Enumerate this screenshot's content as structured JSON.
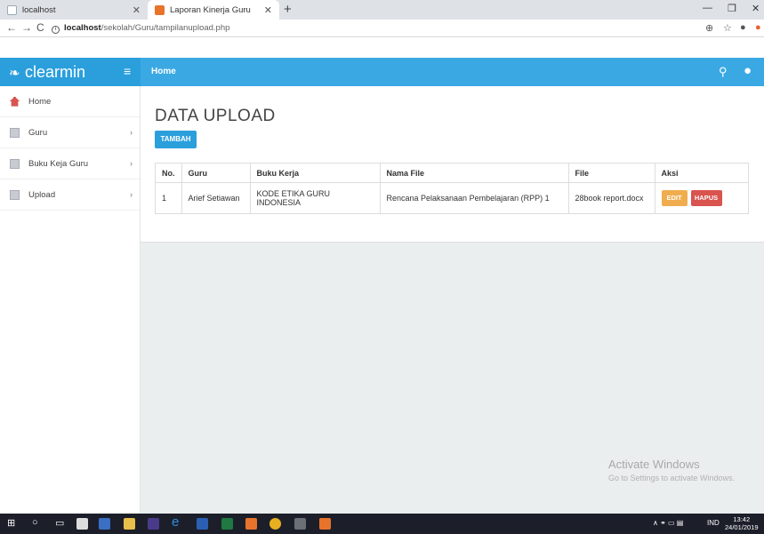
{
  "browser": {
    "tabs": [
      {
        "title": "localhost",
        "active": false
      },
      {
        "title": "Laporan Kinerja Guru",
        "active": true
      }
    ],
    "url_host": "localhost",
    "url_path": "/sekolah/Guru/tampilanupload.php"
  },
  "app": {
    "brand": "clearmin",
    "breadcrumb": "Home",
    "accent_color": "#2a9fdc"
  },
  "sidebar": {
    "items": [
      {
        "label": "Home",
        "icon": "home-icon",
        "has_children": false
      },
      {
        "label": "Guru",
        "icon": "list-icon",
        "has_children": true
      },
      {
        "label": "Buku Keja Guru",
        "icon": "list-icon",
        "has_children": true
      },
      {
        "label": "Upload",
        "icon": "list-icon",
        "has_children": true
      }
    ]
  },
  "main": {
    "title": "DATA UPLOAD",
    "add_button": "TAMBAH",
    "table": {
      "headers": [
        "No.",
        "Guru",
        "Buku Kerja",
        "Nama File",
        "File",
        "Aksi"
      ],
      "rows": [
        {
          "no": "1",
          "guru": "Arief Setiawan",
          "buku_kerja": "KODE ETIKA GURU INDONESIA",
          "nama_file": "Rencana Pelaksanaan Pembelajaran (RPP) 1",
          "file": "28book report.docx",
          "edit": "EDIT",
          "hapus": "HAPUS"
        }
      ]
    }
  },
  "watermark": {
    "line1": "Activate Windows",
    "line2": "Go to Settings to activate Windows."
  },
  "taskbar": {
    "lang": "IND",
    "time": "13:42",
    "date": "24/01/2019"
  }
}
